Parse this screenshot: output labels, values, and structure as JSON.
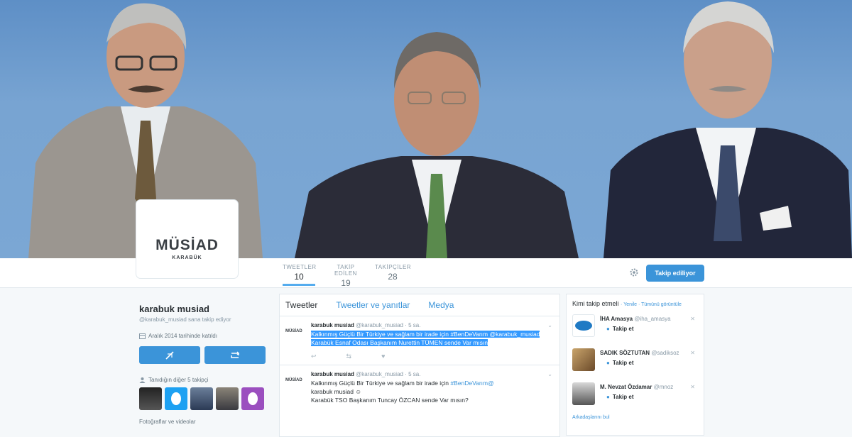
{
  "profile_nav": {
    "stats": [
      {
        "label": "TWEETLER",
        "value": "10",
        "active": true
      },
      {
        "label": "TAKİP EDİLEN",
        "value": "19",
        "active": false
      },
      {
        "label": "TAKİPÇİLER",
        "value": "28",
        "active": false
      }
    ],
    "follow_button": "Takip ediliyor"
  },
  "avatar": {
    "logo_text": "MÜSİAD",
    "logo_sub": "KARABÜK"
  },
  "profile": {
    "name": "karabuk musiad",
    "handle": "@karabuk_musiad sana takip ediyor",
    "joined": "Aralık 2014 tarihinde katıldı",
    "followers_label": "Tanıdığın diğer 5 takipçi",
    "media_label": "Fotoğraflar ve videolar"
  },
  "timeline": {
    "tabs": [
      "Tweetler",
      "Tweetler ve yanıtlar",
      "Medya"
    ],
    "tweets": [
      {
        "name": "karabuk musiad",
        "handle": "@karabuk_musiad",
        "time": "· 5 sa.",
        "logo": "MÜSİAD",
        "text_highlighted": "Kalkınmış Güçlü Bir Türkiye ve sağlam bir irade için #BenDeVarım @karabuk_musiad Karabük Esnaf Odası Başkanım Nurettin TÜMEN sende Var mısın"
      },
      {
        "name": "karabuk musiad",
        "handle": "@karabuk_musiad",
        "time": "· 5 sa.",
        "logo": "MÜSİAD",
        "text_part1": "Kalkınmış Güçlü Bir Türkiye ve sağlam bir irade için ",
        "hashtag": "#BenDeVarım",
        "mention": "@",
        "text_part2": "karabuk musiad",
        "text_line3": "Karabük TSO Başkanım Tuncay ÖZCAN sende Var mısın?"
      }
    ]
  },
  "who_to_follow": {
    "title": "Kimi takip etmeli",
    "refresh": "· Yenile · Tümünü görüntüle",
    "suggestions": [
      {
        "name": "İHA Amasya",
        "handle": "@iha_amasya",
        "button": "Takip et"
      },
      {
        "name": "SADIK SÖZTUTAN",
        "handle": "@sadiksoz",
        "button": "Takip et"
      },
      {
        "name": "M. Nevzat Özdamar",
        "handle": "@mnoz",
        "button": "Takip et"
      }
    ],
    "more": "Arkadaşlarını bul"
  }
}
